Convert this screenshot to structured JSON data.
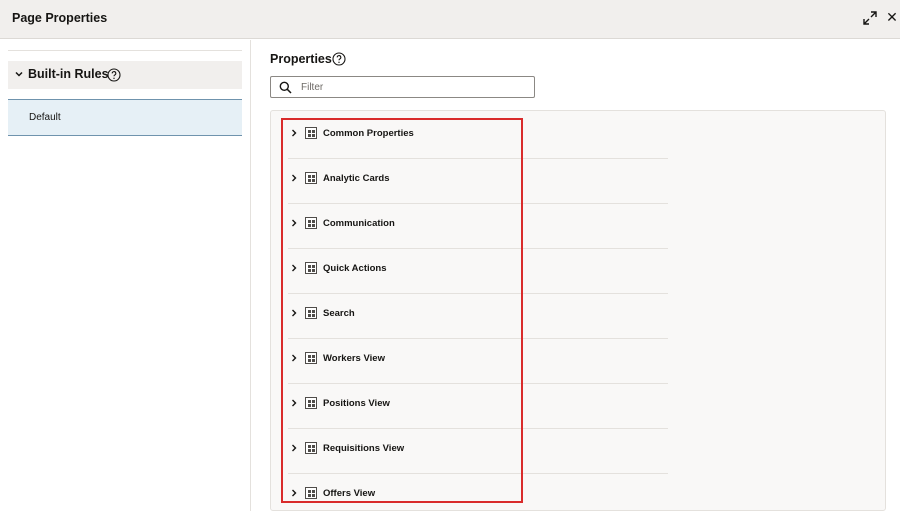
{
  "dialog": {
    "title": "Page Properties",
    "expand_icon": "expand-icon",
    "close_icon": "close-icon",
    "close_glyph": "✕"
  },
  "left": {
    "section_label": "Built-in Rules",
    "items": [
      {
        "label": "Default"
      }
    ]
  },
  "properties": {
    "title": "Properties",
    "filter_placeholder": "Filter",
    "groups": [
      {
        "label": "Common Properties"
      },
      {
        "label": "Analytic Cards"
      },
      {
        "label": "Communication"
      },
      {
        "label": "Quick Actions"
      },
      {
        "label": "Search"
      },
      {
        "label": "Workers View"
      },
      {
        "label": "Positions View"
      },
      {
        "label": "Requisitions View"
      },
      {
        "label": "Offers View"
      }
    ]
  },
  "colors": {
    "accent_highlight": "#d92b2b",
    "selected_bg": "#e6f0f6",
    "selected_border": "#6f93ad"
  }
}
